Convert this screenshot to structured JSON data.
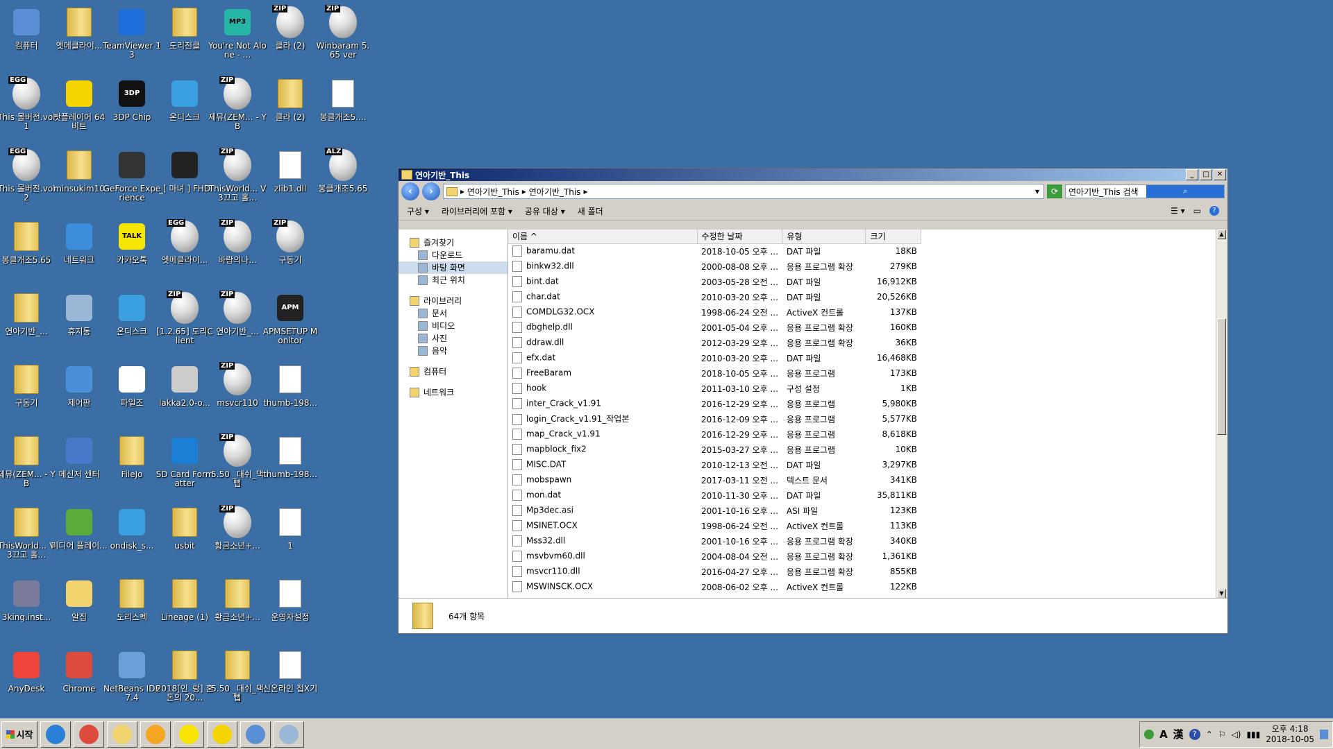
{
  "desktop": {
    "icons": [
      {
        "label": "컴퓨터",
        "kind": "generic",
        "color": "#5a8fd6",
        "col": 0,
        "row": 0
      },
      {
        "label": "엣메클라이...",
        "kind": "folder",
        "col": 1,
        "row": 0
      },
      {
        "label": "TeamViewer 13",
        "kind": "generic",
        "color": "#1e6fd9",
        "col": 2,
        "row": 0
      },
      {
        "label": "도리전클",
        "kind": "folder",
        "col": 3,
        "row": 0
      },
      {
        "label": "You're Not Alone - ...",
        "kind": "generic",
        "color": "#26b6a6",
        "col": 4,
        "row": 0,
        "tag": "MP3"
      },
      {
        "label": "클라 (2)",
        "kind": "egg",
        "tag": "ZIP",
        "col": 5,
        "row": 0
      },
      {
        "label": "Winbaram 5.65 ver",
        "kind": "egg",
        "tag": "ZIP",
        "col": 6,
        "row": 0
      },
      {
        "label": "This 몰버전.vol1",
        "kind": "egg",
        "tag": "EGG",
        "col": 0,
        "row": 1
      },
      {
        "label": "팟플레이어 64 비트",
        "kind": "generic",
        "color": "#f5d400",
        "col": 1,
        "row": 1
      },
      {
        "label": "3DP Chip",
        "kind": "generic",
        "color": "#111111",
        "col": 2,
        "row": 1,
        "tag": "3DP"
      },
      {
        "label": "온디스크",
        "kind": "generic",
        "color": "#3aa0e0",
        "col": 3,
        "row": 1
      },
      {
        "label": "제뮤(ZEM... - YB",
        "kind": "egg",
        "tag": "ZIP",
        "col": 4,
        "row": 1
      },
      {
        "label": "클라 (2)",
        "kind": "folder",
        "col": 5,
        "row": 1
      },
      {
        "label": "봉클개조5....",
        "kind": "doc",
        "col": 6,
        "row": 1
      },
      {
        "label": "This 몰버전.vol2",
        "kind": "egg",
        "tag": "EGG",
        "col": 0,
        "row": 2
      },
      {
        "label": "minsukim10",
        "kind": "folder",
        "col": 1,
        "row": 2
      },
      {
        "label": "GeForce Experience",
        "kind": "generic",
        "color": "#333333",
        "col": 2,
        "row": 2
      },
      {
        "label": "_[ 마녀 ] FHD",
        "kind": "generic",
        "color": "#222222",
        "col": 3,
        "row": 2
      },
      {
        "label": "ThisWorld... V3끄고 홀...",
        "kind": "egg",
        "tag": "ZIP",
        "col": 4,
        "row": 2
      },
      {
        "label": "zlib1.dll",
        "kind": "doc",
        "col": 5,
        "row": 2
      },
      {
        "label": "봉클개조5.65",
        "kind": "egg",
        "tag": "ALZ",
        "col": 6,
        "row": 2
      },
      {
        "label": "봉클개조5.65",
        "kind": "folder",
        "col": 0,
        "row": 3
      },
      {
        "label": "네트워크",
        "kind": "generic",
        "color": "#3c8edc",
        "col": 1,
        "row": 3
      },
      {
        "label": "카카오톡",
        "kind": "generic",
        "color": "#f7e600",
        "col": 2,
        "row": 3,
        "tag": "TALK"
      },
      {
        "label": "엣메클라이...",
        "kind": "egg",
        "tag": "EGG",
        "col": 3,
        "row": 3
      },
      {
        "label": "바람의나...",
        "kind": "egg",
        "tag": "ZIP",
        "col": 4,
        "row": 3
      },
      {
        "label": "구동기",
        "kind": "egg",
        "tag": "ZIP",
        "col": 5,
        "row": 3
      },
      {
        "label": "연아기반_...",
        "kind": "folder",
        "col": 0,
        "row": 4
      },
      {
        "label": "휴지통",
        "kind": "generic",
        "color": "#9bb7d6",
        "col": 1,
        "row": 4
      },
      {
        "label": "온디스크",
        "kind": "generic",
        "color": "#3aa0e0",
        "col": 2,
        "row": 4
      },
      {
        "label": "[1.2.65] 도리Client",
        "kind": "egg",
        "tag": "ZIP",
        "col": 3,
        "row": 4
      },
      {
        "label": "연아기반_...",
        "kind": "egg",
        "tag": "ZIP",
        "col": 4,
        "row": 4
      },
      {
        "label": "APMSETUP Monitor",
        "kind": "generic",
        "color": "#222222",
        "col": 5,
        "row": 4,
        "tag": "APM"
      },
      {
        "label": "구동기",
        "kind": "folder",
        "col": 0,
        "row": 5
      },
      {
        "label": "제어판",
        "kind": "generic",
        "color": "#4a90d9",
        "col": 1,
        "row": 5
      },
      {
        "label": "파일조",
        "kind": "generic",
        "color": "#ffffff",
        "col": 2,
        "row": 5
      },
      {
        "label": "lakka2.0-o...",
        "kind": "generic",
        "color": "#cccccc",
        "col": 3,
        "row": 5
      },
      {
        "label": "msvcr110",
        "kind": "egg",
        "tag": "ZIP",
        "col": 4,
        "row": 5
      },
      {
        "label": "thumb-198...",
        "kind": "doc",
        "col": 5,
        "row": 5
      },
      {
        "label": "제뮤(ZEM... - YB",
        "kind": "folder",
        "col": 0,
        "row": 6
      },
      {
        "label": "메신저 센터",
        "kind": "generic",
        "color": "#4a78c8",
        "col": 1,
        "row": 6
      },
      {
        "label": "FileJo",
        "kind": "folder",
        "col": 2,
        "row": 6
      },
      {
        "label": "SD Card Formatter",
        "kind": "generic",
        "color": "#1c7fd6",
        "col": 3,
        "row": 6
      },
      {
        "label": "5.50 _대쉬_댁뻡",
        "kind": "egg",
        "tag": "ZIP",
        "col": 4,
        "row": 6
      },
      {
        "label": "thumb-198...",
        "kind": "doc",
        "col": 5,
        "row": 6
      },
      {
        "label": "ThisWorld... V3끄고 홀...",
        "kind": "folder",
        "col": 0,
        "row": 7
      },
      {
        "label": "미디어 플레이...",
        "kind": "generic",
        "color": "#5aaa3c",
        "col": 1,
        "row": 7
      },
      {
        "label": "ondisk_s...",
        "kind": "generic",
        "color": "#3aa0e0",
        "col": 2,
        "row": 7
      },
      {
        "label": "usbit",
        "kind": "folder",
        "col": 3,
        "row": 7
      },
      {
        "label": "황금소년+...",
        "kind": "egg",
        "tag": "ZIP",
        "col": 4,
        "row": 7
      },
      {
        "label": "1",
        "kind": "doc",
        "col": 5,
        "row": 7
      },
      {
        "label": "3king.inst...",
        "kind": "generic",
        "color": "#7a7a9a",
        "col": 0,
        "row": 8
      },
      {
        "label": "알집",
        "kind": "generic",
        "color": "#f2d46f",
        "col": 1,
        "row": 8
      },
      {
        "label": "도리스펙",
        "kind": "folder",
        "col": 2,
        "row": 8
      },
      {
        "label": "Lineage (1)",
        "kind": "folder",
        "col": 3,
        "row": 8
      },
      {
        "label": "황금소년+...",
        "kind": "folder",
        "col": 4,
        "row": 8
      },
      {
        "label": "운영자설정",
        "kind": "doc",
        "col": 5,
        "row": 8
      },
      {
        "label": "AnyDesk",
        "kind": "generic",
        "color": "#ef443b",
        "col": 0,
        "row": 9
      },
      {
        "label": "Chrome",
        "kind": "generic",
        "color": "#dd4b3e",
        "col": 1,
        "row": 9
      },
      {
        "label": "NetBeans IDE 7.4",
        "kind": "generic",
        "color": "#6aa0d8",
        "col": 2,
        "row": 9
      },
      {
        "label": "2018[인_랑] 혼돈의 20...",
        "kind": "folder",
        "col": 3,
        "row": 9
      },
      {
        "label": "5.50 _대쉬_댁뻡",
        "kind": "folder",
        "col": 4,
        "row": 9
      },
      {
        "label": "신온라인 접X기",
        "kind": "doc",
        "col": 5,
        "row": 9
      }
    ]
  },
  "window": {
    "title": "연아기반_This",
    "controls": {
      "minimize": "_",
      "maximize": "□",
      "close": "✕"
    },
    "address": {
      "part1": "연아기반_This",
      "part2": "연아기반_This",
      "sep": "▸"
    },
    "search_placeholder": "연아기반_This 검색",
    "toolbar": {
      "organize": "구성 ▾",
      "include_library": "라이브러리에 포함 ▾",
      "share": "공유 대상 ▾",
      "new_folder": "새 폴더"
    },
    "nav": [
      {
        "label": "즐겨찾기",
        "indent": 0
      },
      {
        "label": "다운로드",
        "indent": 1
      },
      {
        "label": "바탕 화면",
        "indent": 1,
        "selected": true
      },
      {
        "label": "최근 위치",
        "indent": 1
      },
      {
        "label": "",
        "indent": 0,
        "spacer": true
      },
      {
        "label": "라이브러리",
        "indent": 0
      },
      {
        "label": "문서",
        "indent": 1
      },
      {
        "label": "비디오",
        "indent": 1
      },
      {
        "label": "사진",
        "indent": 1
      },
      {
        "label": "음악",
        "indent": 1
      },
      {
        "label": "",
        "indent": 0,
        "spacer": true
      },
      {
        "label": "컴퓨터",
        "indent": 0
      },
      {
        "label": "",
        "indent": 0,
        "spacer": true
      },
      {
        "label": "네트워크",
        "indent": 0
      }
    ],
    "columns": {
      "name": "이름",
      "date": "수정한 날짜",
      "type": "유형",
      "size": "크기"
    },
    "files": [
      {
        "name": "baramu.dat",
        "date": "2018-10-05 오후 ...",
        "type": "DAT 파일",
        "size": "18KB"
      },
      {
        "name": "binkw32.dll",
        "date": "2000-08-08 오후 ...",
        "type": "응용 프로그램 확장",
        "size": "279KB"
      },
      {
        "name": "bint.dat",
        "date": "2003-05-28 오전 ...",
        "type": "DAT 파일",
        "size": "16,912KB"
      },
      {
        "name": "char.dat",
        "date": "2010-03-20 오후 ...",
        "type": "DAT 파일",
        "size": "20,526KB"
      },
      {
        "name": "COMDLG32.OCX",
        "date": "1998-06-24 오전 ...",
        "type": "ActiveX 컨트롤",
        "size": "137KB"
      },
      {
        "name": "dbghelp.dll",
        "date": "2001-05-04 오후 ...",
        "type": "응용 프로그램 확장",
        "size": "160KB"
      },
      {
        "name": "ddraw.dll",
        "date": "2012-03-29 오후 ...",
        "type": "응용 프로그램 확장",
        "size": "36KB"
      },
      {
        "name": "efx.dat",
        "date": "2010-03-20 오후 ...",
        "type": "DAT 파일",
        "size": "16,468KB"
      },
      {
        "name": "FreeBaram",
        "date": "2018-10-05 오후 ...",
        "type": "응용 프로그램",
        "size": "173KB"
      },
      {
        "name": "hook",
        "date": "2011-03-10 오후 ...",
        "type": "구성 설정",
        "size": "1KB"
      },
      {
        "name": "inter_Crack_v1.91",
        "date": "2016-12-29 오후 ...",
        "type": "응용 프로그램",
        "size": "5,980KB"
      },
      {
        "name": "login_Crack_v1.91_작업본",
        "date": "2016-12-09 오후 ...",
        "type": "응용 프로그램",
        "size": "5,577KB"
      },
      {
        "name": "map_Crack_v1.91",
        "date": "2016-12-29 오후 ...",
        "type": "응용 프로그램",
        "size": "8,618KB"
      },
      {
        "name": "mapblock_fix2",
        "date": "2015-03-27 오후 ...",
        "type": "응용 프로그램",
        "size": "10KB"
      },
      {
        "name": "MISC.DAT",
        "date": "2010-12-13 오전 ...",
        "type": "DAT 파일",
        "size": "3,297KB"
      },
      {
        "name": "mobspawn",
        "date": "2017-03-11 오전 ...",
        "type": "텍스트 문서",
        "size": "341KB"
      },
      {
        "name": "mon.dat",
        "date": "2010-11-30 오후 ...",
        "type": "DAT 파일",
        "size": "35,811KB"
      },
      {
        "name": "Mp3dec.asi",
        "date": "2001-10-16 오후 ...",
        "type": "ASI 파일",
        "size": "123KB"
      },
      {
        "name": "MSINET.OCX",
        "date": "1998-06-24 오전 ...",
        "type": "ActiveX 컨트롤",
        "size": "113KB"
      },
      {
        "name": "Mss32.dll",
        "date": "2001-10-16 오후 ...",
        "type": "응용 프로그램 확장",
        "size": "340KB"
      },
      {
        "name": "msvbvm60.dll",
        "date": "2004-08-04 오전 ...",
        "type": "응용 프로그램 확장",
        "size": "1,361KB"
      },
      {
        "name": "msvcr110.dll",
        "date": "2016-04-27 오후 ...",
        "type": "응용 프로그램 확장",
        "size": "855KB"
      },
      {
        "name": "MSWINSCK.OCX",
        "date": "2008-06-02 오후 ...",
        "type": "ActiveX 컨트롤",
        "size": "122KB"
      }
    ],
    "status": "64개 항목"
  },
  "taskbar": {
    "start": "시작",
    "quick": [
      {
        "name": "ie-icon",
        "color": "#2a7fd6"
      },
      {
        "name": "chrome-icon",
        "color": "#dd4b3e"
      },
      {
        "name": "explorer-icon",
        "color": "#f2d46f"
      },
      {
        "name": "media-icon",
        "color": "#f5a623"
      },
      {
        "name": "kakaotalk-icon",
        "color": "#f7e600"
      },
      {
        "name": "potplayer-icon",
        "color": "#f5d400"
      },
      {
        "name": "screen-icon",
        "color": "#5a8fd6"
      },
      {
        "name": "window-icon",
        "color": "#9bb7d6"
      }
    ],
    "ime_a": "A",
    "ime_han": "漢",
    "help": "?",
    "clock_time": "오후 4:18",
    "clock_date": "2018-10-05"
  }
}
